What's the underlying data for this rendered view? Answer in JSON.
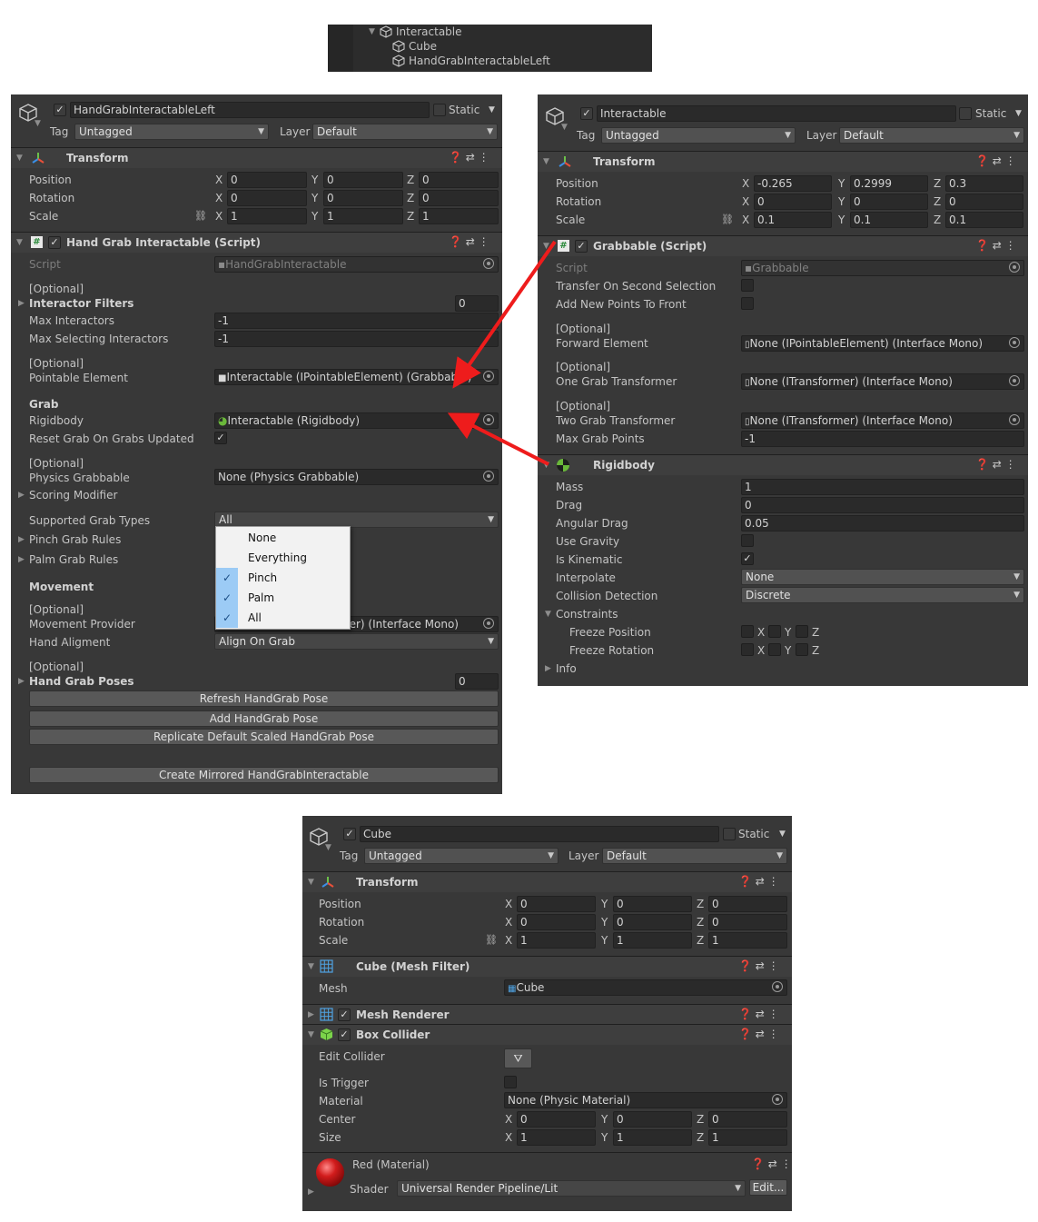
{
  "hierarchy": {
    "items": [
      "Interactable",
      "Cube",
      "HandGrabInteractableLeft"
    ]
  },
  "left": {
    "object_name": "HandGrabInteractableLeft",
    "static_label": "Static",
    "tag_label": "Tag",
    "tag_value": "Untagged",
    "layer_label": "Layer",
    "layer_value": "Default",
    "transform": {
      "title": "Transform",
      "position_label": "Position",
      "rotation_label": "Rotation",
      "scale_label": "Scale",
      "position": [
        "0",
        "0",
        "0"
      ],
      "rotation": [
        "0",
        "0",
        "0"
      ],
      "scale": [
        "1",
        "1",
        "1"
      ]
    },
    "script": {
      "title": "Hand Grab Interactable (Script)",
      "script_label": "Script",
      "script_value": "HandGrabInteractable",
      "opt1": "[Optional]",
      "interactor_filters": "Interactor Filters",
      "interactor_filters_count": "0",
      "max_interactors_label": "Max Interactors",
      "max_interactors": "-1",
      "max_selecting_label": "Max Selecting Interactors",
      "max_selecting": "-1",
      "opt2": "[Optional]",
      "pointable_label": "Pointable Element",
      "pointable_value": "Interactable (IPointableElement) (Grabbable)",
      "grab_header": "Grab",
      "rigidbody_label": "Rigidbody",
      "rigidbody_value": "Interactable (Rigidbody)",
      "reset_grab_label": "Reset Grab On Grabs Updated",
      "opt3": "[Optional]",
      "physics_grabbable_label": "Physics Grabbable",
      "physics_grabbable_value": "None (Physics Grabbable)",
      "scoring_modifier": "Scoring Modifier",
      "supported_grab_types_label": "Supported Grab Types",
      "supported_grab_types_value": "All",
      "pinch_rules": "Pinch Grab Rules",
      "palm_rules": "Palm Grab Rules",
      "movement_header": "Movement",
      "opt4": "[Optional]",
      "movement_provider_label": "Movement Provider",
      "movement_provider_value": "der) (Interface Mono)",
      "hand_alignment_label": "Hand Aligment",
      "hand_alignment_value": "Align On Grab",
      "opt5": "[Optional]",
      "hand_grab_poses": "Hand Grab Poses",
      "hand_grab_poses_count": "0",
      "btn_refresh": "Refresh HandGrab Pose",
      "btn_add": "Add HandGrab Pose",
      "btn_replicate": "Replicate Default Scaled HandGrab Pose",
      "btn_mirror": "Create Mirrored HandGrabInteractable"
    },
    "dropdown_menu": [
      {
        "label": "None",
        "checked": false
      },
      {
        "label": "Everything",
        "checked": false
      },
      {
        "label": "Pinch",
        "checked": true
      },
      {
        "label": "Palm",
        "checked": true
      },
      {
        "label": "All",
        "checked": true
      }
    ]
  },
  "right": {
    "object_name": "Interactable",
    "static_label": "Static",
    "tag_label": "Tag",
    "tag_value": "Untagged",
    "layer_label": "Layer",
    "layer_value": "Default",
    "transform": {
      "title": "Transform",
      "position_label": "Position",
      "rotation_label": "Rotation",
      "scale_label": "Scale",
      "position": [
        "-0.265",
        "0.2999",
        "0.3"
      ],
      "rotation": [
        "0",
        "0",
        "0"
      ],
      "scale": [
        "0.1",
        "0.1",
        "0.1"
      ]
    },
    "grabbable": {
      "title": "Grabbable (Script)",
      "script_label": "Script",
      "script_value": "Grabbable",
      "transfer_label": "Transfer On Second Selection",
      "add_points_label": "Add New Points To Front",
      "opt1": "[Optional]",
      "forward_label": "Forward Element",
      "forward_value": "None (IPointableElement) (Interface Mono)",
      "opt2": "[Optional]",
      "one_grab_label": "One Grab Transformer",
      "one_grab_value": "None (ITransformer) (Interface Mono)",
      "opt3": "[Optional]",
      "two_grab_label": "Two Grab Transformer",
      "two_grab_value": "None (ITransformer) (Interface Mono)",
      "max_points_label": "Max Grab Points",
      "max_points": "-1"
    },
    "rigidbody": {
      "title": "Rigidbody",
      "mass_label": "Mass",
      "mass": "1",
      "drag_label": "Drag",
      "drag": "0",
      "angular_label": "Angular Drag",
      "angular": "0.05",
      "gravity_label": "Use Gravity",
      "kinematic_label": "Is Kinematic",
      "interpolate_label": "Interpolate",
      "interpolate": "None",
      "collision_label": "Collision Detection",
      "collision": "Discrete",
      "constraints_label": "Constraints",
      "freeze_pos_label": "Freeze Position",
      "freeze_rot_label": "Freeze Rotation",
      "info_label": "Info"
    }
  },
  "bottom": {
    "object_name": "Cube",
    "static_label": "Static",
    "tag_label": "Tag",
    "tag_value": "Untagged",
    "layer_label": "Layer",
    "layer_value": "Default",
    "transform": {
      "title": "Transform",
      "position_label": "Position",
      "rotation_label": "Rotation",
      "scale_label": "Scale",
      "position": [
        "0",
        "0",
        "0"
      ],
      "rotation": [
        "0",
        "0",
        "0"
      ],
      "scale": [
        "1",
        "1",
        "1"
      ]
    },
    "mesh_filter": {
      "title": "Cube (Mesh Filter)",
      "mesh_label": "Mesh",
      "mesh_value": "Cube"
    },
    "mesh_renderer": {
      "title": "Mesh Renderer"
    },
    "box_collider": {
      "title": "Box Collider",
      "edit_label": "Edit Collider",
      "trigger_label": "Is Trigger",
      "material_label": "Material",
      "material_value": "None (Physic Material)",
      "center_label": "Center",
      "center": [
        "0",
        "0",
        "0"
      ],
      "size_label": "Size",
      "size": [
        "1",
        "1",
        "1"
      ]
    },
    "material": {
      "title": "Red (Material)",
      "shader_label": "Shader",
      "shader_value": "Universal Render Pipeline/Lit",
      "edit_btn": "Edit..."
    }
  },
  "colors": {
    "arrow": "#ee1c1c",
    "panel_bg": "#383838",
    "menu_check": "#9ccbf5"
  }
}
